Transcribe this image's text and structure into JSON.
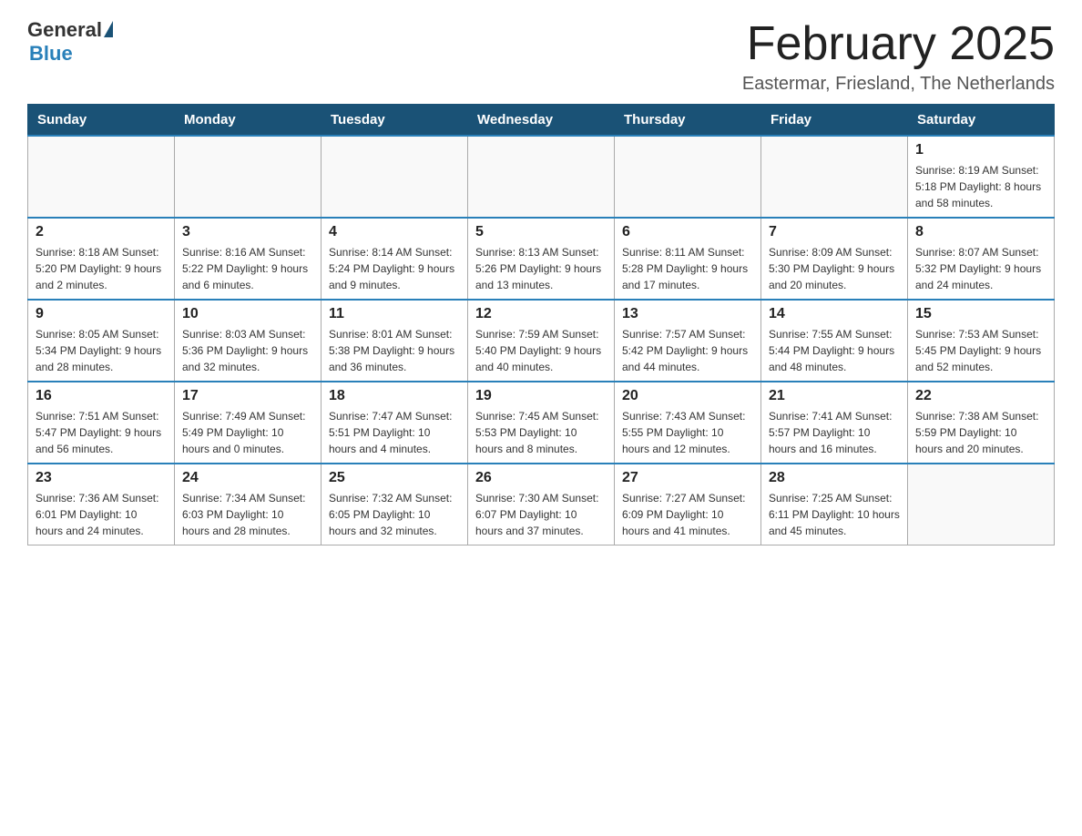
{
  "header": {
    "logo": {
      "general": "General",
      "blue": "Blue"
    },
    "title": "February 2025",
    "location": "Eastermar, Friesland, The Netherlands"
  },
  "days_of_week": [
    "Sunday",
    "Monday",
    "Tuesday",
    "Wednesday",
    "Thursday",
    "Friday",
    "Saturday"
  ],
  "weeks": [
    [
      {
        "day": "",
        "info": ""
      },
      {
        "day": "",
        "info": ""
      },
      {
        "day": "",
        "info": ""
      },
      {
        "day": "",
        "info": ""
      },
      {
        "day": "",
        "info": ""
      },
      {
        "day": "",
        "info": ""
      },
      {
        "day": "1",
        "info": "Sunrise: 8:19 AM\nSunset: 5:18 PM\nDaylight: 8 hours and 58 minutes."
      }
    ],
    [
      {
        "day": "2",
        "info": "Sunrise: 8:18 AM\nSunset: 5:20 PM\nDaylight: 9 hours and 2 minutes."
      },
      {
        "day": "3",
        "info": "Sunrise: 8:16 AM\nSunset: 5:22 PM\nDaylight: 9 hours and 6 minutes."
      },
      {
        "day": "4",
        "info": "Sunrise: 8:14 AM\nSunset: 5:24 PM\nDaylight: 9 hours and 9 minutes."
      },
      {
        "day": "5",
        "info": "Sunrise: 8:13 AM\nSunset: 5:26 PM\nDaylight: 9 hours and 13 minutes."
      },
      {
        "day": "6",
        "info": "Sunrise: 8:11 AM\nSunset: 5:28 PM\nDaylight: 9 hours and 17 minutes."
      },
      {
        "day": "7",
        "info": "Sunrise: 8:09 AM\nSunset: 5:30 PM\nDaylight: 9 hours and 20 minutes."
      },
      {
        "day": "8",
        "info": "Sunrise: 8:07 AM\nSunset: 5:32 PM\nDaylight: 9 hours and 24 minutes."
      }
    ],
    [
      {
        "day": "9",
        "info": "Sunrise: 8:05 AM\nSunset: 5:34 PM\nDaylight: 9 hours and 28 minutes."
      },
      {
        "day": "10",
        "info": "Sunrise: 8:03 AM\nSunset: 5:36 PM\nDaylight: 9 hours and 32 minutes."
      },
      {
        "day": "11",
        "info": "Sunrise: 8:01 AM\nSunset: 5:38 PM\nDaylight: 9 hours and 36 minutes."
      },
      {
        "day": "12",
        "info": "Sunrise: 7:59 AM\nSunset: 5:40 PM\nDaylight: 9 hours and 40 minutes."
      },
      {
        "day": "13",
        "info": "Sunrise: 7:57 AM\nSunset: 5:42 PM\nDaylight: 9 hours and 44 minutes."
      },
      {
        "day": "14",
        "info": "Sunrise: 7:55 AM\nSunset: 5:44 PM\nDaylight: 9 hours and 48 minutes."
      },
      {
        "day": "15",
        "info": "Sunrise: 7:53 AM\nSunset: 5:45 PM\nDaylight: 9 hours and 52 minutes."
      }
    ],
    [
      {
        "day": "16",
        "info": "Sunrise: 7:51 AM\nSunset: 5:47 PM\nDaylight: 9 hours and 56 minutes."
      },
      {
        "day": "17",
        "info": "Sunrise: 7:49 AM\nSunset: 5:49 PM\nDaylight: 10 hours and 0 minutes."
      },
      {
        "day": "18",
        "info": "Sunrise: 7:47 AM\nSunset: 5:51 PM\nDaylight: 10 hours and 4 minutes."
      },
      {
        "day": "19",
        "info": "Sunrise: 7:45 AM\nSunset: 5:53 PM\nDaylight: 10 hours and 8 minutes."
      },
      {
        "day": "20",
        "info": "Sunrise: 7:43 AM\nSunset: 5:55 PM\nDaylight: 10 hours and 12 minutes."
      },
      {
        "day": "21",
        "info": "Sunrise: 7:41 AM\nSunset: 5:57 PM\nDaylight: 10 hours and 16 minutes."
      },
      {
        "day": "22",
        "info": "Sunrise: 7:38 AM\nSunset: 5:59 PM\nDaylight: 10 hours and 20 minutes."
      }
    ],
    [
      {
        "day": "23",
        "info": "Sunrise: 7:36 AM\nSunset: 6:01 PM\nDaylight: 10 hours and 24 minutes."
      },
      {
        "day": "24",
        "info": "Sunrise: 7:34 AM\nSunset: 6:03 PM\nDaylight: 10 hours and 28 minutes."
      },
      {
        "day": "25",
        "info": "Sunrise: 7:32 AM\nSunset: 6:05 PM\nDaylight: 10 hours and 32 minutes."
      },
      {
        "day": "26",
        "info": "Sunrise: 7:30 AM\nSunset: 6:07 PM\nDaylight: 10 hours and 37 minutes."
      },
      {
        "day": "27",
        "info": "Sunrise: 7:27 AM\nSunset: 6:09 PM\nDaylight: 10 hours and 41 minutes."
      },
      {
        "day": "28",
        "info": "Sunrise: 7:25 AM\nSunset: 6:11 PM\nDaylight: 10 hours and 45 minutes."
      },
      {
        "day": "",
        "info": ""
      }
    ]
  ]
}
